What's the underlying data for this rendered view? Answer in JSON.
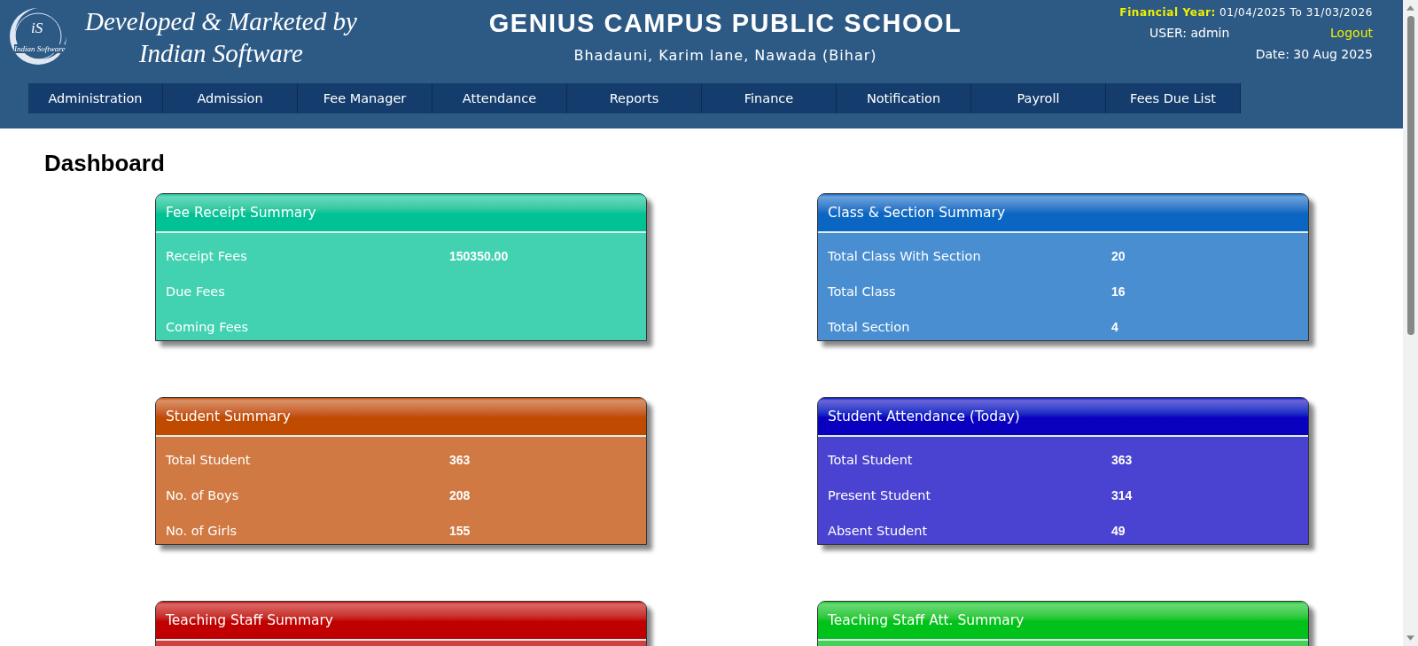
{
  "header": {
    "logo_mark": "iS",
    "logo_caption": "Indian Software",
    "tagline_1": "Developed & Marketed by",
    "tagline_2": "Indian Software",
    "school_name": "GENIUS CAMPUS PUBLIC SCHOOL",
    "address": "Bhadauni, Karim lane, Nawada (Bihar)",
    "financial_year_label": "Financial Year:",
    "financial_year": "01/04/2025 To 31/03/2026",
    "user": "USER: admin",
    "logout": "Logout",
    "date": "Date: 30 Aug 2025"
  },
  "nav": [
    "Administration",
    "Admission",
    "Fee Manager",
    "Attendance",
    "Reports",
    "Finance",
    "Notification",
    "Payroll",
    "Fees Due List"
  ],
  "page_title": "Dashboard",
  "cards": [
    {
      "title": "Fee Receipt Summary",
      "color": "#00c295",
      "rows": [
        {
          "label": "Receipt Fees",
          "value": "150350.00"
        },
        {
          "label": "Due Fees"
        },
        {
          "label": "Coming Fees"
        }
      ]
    },
    {
      "title": "Class & Section Summary",
      "color": "#0a66c2",
      "rows": [
        {
          "label": "Total Class With Section",
          "value": "20"
        },
        {
          "label": "Total Class",
          "value": "16"
        },
        {
          "label": "Total Section",
          "value": "4"
        }
      ]
    },
    {
      "title": "Student Summary",
      "color": "#c04a00",
      "rows": [
        {
          "label": "Total Student",
          "value": "363"
        },
        {
          "label": "No. of Boys",
          "value": "208"
        },
        {
          "label": "No. of Girls",
          "value": "155"
        }
      ]
    },
    {
      "title": "Student Attendance (Today)",
      "color": "#0a00c0",
      "rows": [
        {
          "label": "Total Student",
          "value": "363"
        },
        {
          "label": "Present Student",
          "value": "314"
        },
        {
          "label": "Absent Student",
          "value": "49"
        }
      ]
    },
    {
      "title": "Teaching Staff Summary",
      "color": "#c00000"
    },
    {
      "title": "Teaching Staff Att. Summary",
      "color": "#00c21a"
    }
  ]
}
